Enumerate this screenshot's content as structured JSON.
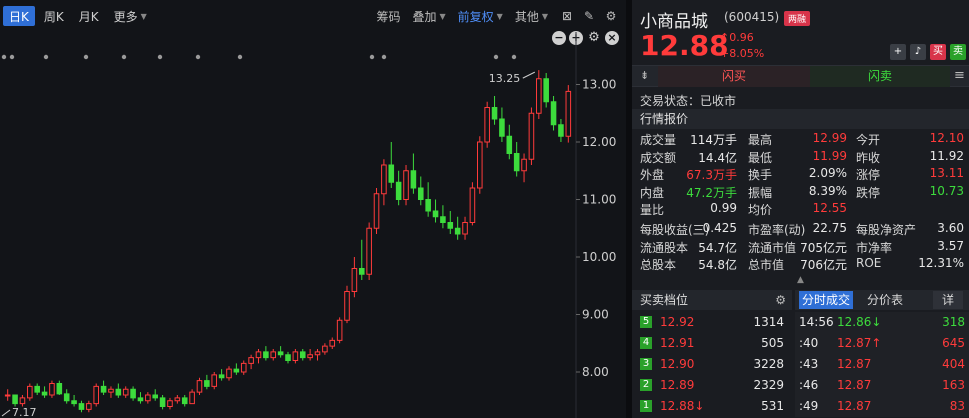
{
  "toolbar": {
    "periods": [
      "日K",
      "周K",
      "月K",
      "更多"
    ],
    "right_items": [
      "筹码",
      "叠加",
      "前复权",
      "其他"
    ]
  },
  "chart_data": {
    "type": "candlestick",
    "y_ticks": [
      "13.00",
      "12.00",
      "11.00",
      "10.00",
      "9.00",
      "8.00"
    ],
    "y_range": [
      7.2,
      13.6
    ],
    "max_label": "13.25",
    "min_label": "7.17",
    "candles": [
      [
        7.6,
        7.7,
        7.5,
        7.6
      ],
      [
        7.6,
        7.6,
        7.4,
        7.45
      ],
      [
        7.45,
        7.6,
        7.4,
        7.55
      ],
      [
        7.55,
        7.8,
        7.5,
        7.75
      ],
      [
        7.75,
        7.8,
        7.6,
        7.65
      ],
      [
        7.65,
        7.75,
        7.55,
        7.6
      ],
      [
        7.6,
        7.85,
        7.55,
        7.8
      ],
      [
        7.8,
        7.85,
        7.6,
        7.62
      ],
      [
        7.62,
        7.7,
        7.45,
        7.5
      ],
      [
        7.5,
        7.6,
        7.4,
        7.45
      ],
      [
        7.45,
        7.5,
        7.3,
        7.35
      ],
      [
        7.35,
        7.5,
        7.3,
        7.45
      ],
      [
        7.45,
        7.8,
        7.4,
        7.75
      ],
      [
        7.75,
        7.85,
        7.6,
        7.65
      ],
      [
        7.65,
        7.75,
        7.55,
        7.7
      ],
      [
        7.7,
        7.8,
        7.55,
        7.6
      ],
      [
        7.6,
        7.75,
        7.55,
        7.7
      ],
      [
        7.7,
        7.75,
        7.5,
        7.55
      ],
      [
        7.55,
        7.65,
        7.45,
        7.5
      ],
      [
        7.5,
        7.65,
        7.45,
        7.6
      ],
      [
        7.6,
        7.7,
        7.5,
        7.55
      ],
      [
        7.55,
        7.6,
        7.35,
        7.4
      ],
      [
        7.4,
        7.55,
        7.35,
        7.5
      ],
      [
        7.5,
        7.6,
        7.45,
        7.55
      ],
      [
        7.55,
        7.6,
        7.4,
        7.45
      ],
      [
        7.45,
        7.7,
        7.45,
        7.65
      ],
      [
        7.65,
        7.9,
        7.6,
        7.85
      ],
      [
        7.85,
        7.95,
        7.7,
        7.75
      ],
      [
        7.75,
        8.0,
        7.7,
        7.95
      ],
      [
        7.95,
        8.05,
        7.85,
        7.9
      ],
      [
        7.9,
        8.1,
        7.85,
        8.05
      ],
      [
        8.05,
        8.15,
        7.95,
        8.0
      ],
      [
        8.0,
        8.2,
        7.95,
        8.15
      ],
      [
        8.15,
        8.3,
        8.05,
        8.25
      ],
      [
        8.25,
        8.4,
        8.15,
        8.35
      ],
      [
        8.35,
        8.45,
        8.2,
        8.25
      ],
      [
        8.25,
        8.4,
        8.2,
        8.35
      ],
      [
        8.35,
        8.45,
        8.25,
        8.3
      ],
      [
        8.3,
        8.35,
        8.15,
        8.2
      ],
      [
        8.2,
        8.4,
        8.15,
        8.35
      ],
      [
        8.35,
        8.4,
        8.2,
        8.25
      ],
      [
        8.25,
        8.4,
        8.2,
        8.3
      ],
      [
        8.3,
        8.4,
        8.2,
        8.35
      ],
      [
        8.35,
        8.5,
        8.3,
        8.45
      ],
      [
        8.45,
        8.6,
        8.4,
        8.55
      ],
      [
        8.55,
        8.95,
        8.5,
        8.9
      ],
      [
        8.9,
        9.5,
        8.85,
        9.4
      ],
      [
        9.4,
        10.0,
        9.3,
        9.8
      ],
      [
        9.8,
        10.3,
        9.6,
        9.7
      ],
      [
        9.7,
        10.6,
        9.6,
        10.5
      ],
      [
        10.5,
        11.2,
        10.4,
        11.1
      ],
      [
        11.1,
        11.7,
        10.9,
        11.6
      ],
      [
        11.6,
        12.0,
        11.2,
        11.3
      ],
      [
        11.3,
        11.5,
        10.9,
        11.0
      ],
      [
        11.0,
        11.6,
        10.9,
        11.5
      ],
      [
        11.5,
        11.8,
        11.1,
        11.2
      ],
      [
        11.2,
        11.4,
        10.9,
        11.0
      ],
      [
        11.0,
        11.3,
        10.7,
        10.8
      ],
      [
        10.8,
        11.0,
        10.6,
        10.7
      ],
      [
        10.7,
        10.9,
        10.5,
        10.6
      ],
      [
        10.6,
        10.8,
        10.4,
        10.5
      ],
      [
        10.5,
        10.7,
        10.3,
        10.4
      ],
      [
        10.4,
        10.7,
        10.3,
        10.6
      ],
      [
        10.6,
        11.3,
        10.55,
        11.2
      ],
      [
        11.2,
        12.1,
        11.1,
        12.0
      ],
      [
        12.0,
        12.7,
        11.9,
        12.6
      ],
      [
        12.6,
        12.8,
        12.3,
        12.4
      ],
      [
        12.4,
        12.6,
        12.0,
        12.1
      ],
      [
        12.1,
        12.3,
        11.7,
        11.8
      ],
      [
        11.8,
        12.0,
        11.4,
        11.5
      ],
      [
        11.5,
        11.8,
        11.3,
        11.7
      ],
      [
        11.7,
        12.6,
        11.6,
        12.5
      ],
      [
        12.5,
        13.25,
        12.4,
        13.1
      ],
      [
        13.1,
        13.2,
        12.6,
        12.7
      ],
      [
        12.7,
        12.8,
        12.2,
        12.3
      ],
      [
        12.3,
        12.4,
        12.0,
        12.1
      ],
      [
        12.1,
        12.99,
        11.99,
        12.88
      ]
    ]
  },
  "stock": {
    "name": "小商品城",
    "code": "(600415)",
    "tag": "两融",
    "price": "12.88",
    "change": "0.96",
    "pct": "+8.05%"
  },
  "action_buttons": [
    "+",
    "♪",
    "买",
    "卖"
  ],
  "flash": {
    "buy": "闪买",
    "sell": "闪卖"
  },
  "trade_status": "交易状态：已收市",
  "quote_header": "行情报价",
  "quote_rows": [
    [
      [
        "成交量",
        "114万手",
        "white"
      ],
      [
        "最高",
        "12.99",
        "up"
      ],
      [
        "今开",
        "12.10",
        "up"
      ]
    ],
    [
      [
        "成交额",
        "14.4亿",
        "white"
      ],
      [
        "最低",
        "11.99",
        "up"
      ],
      [
        "昨收",
        "11.92",
        "white"
      ]
    ],
    [
      [
        "外盘",
        "67.3万手",
        "up"
      ],
      [
        "换手",
        "2.09%",
        "white"
      ],
      [
        "涨停",
        "13.11",
        "up"
      ]
    ],
    [
      [
        "内盘",
        "47.2万手",
        "down"
      ],
      [
        "振幅",
        "8.39%",
        "white"
      ],
      [
        "跌停",
        "10.73",
        "down"
      ]
    ],
    [
      [
        "量比",
        "0.99",
        "white"
      ],
      [
        "均价",
        "12.55",
        "up"
      ],
      [
        "",
        "",
        " white"
      ]
    ]
  ],
  "fund_rows": [
    [
      [
        "每股收益(三)",
        "0.425",
        "white"
      ],
      [
        "市盈率(动)",
        "22.75",
        "white"
      ],
      [
        "每股净资产",
        "3.60",
        "white"
      ]
    ],
    [
      [
        "流通股本",
        "54.7亿",
        "white"
      ],
      [
        "流通市值",
        "705亿元",
        "white"
      ],
      [
        "市净率",
        "3.57",
        "white"
      ]
    ],
    [
      [
        "总股本",
        "54.8亿",
        "white"
      ],
      [
        "总市值",
        "706亿元",
        "white"
      ],
      [
        "ROE",
        "12.31%",
        "white"
      ]
    ]
  ],
  "orderbook_header": "买卖档位",
  "orderbook": [
    [
      "5",
      "12.92",
      "1314"
    ],
    [
      "4",
      "12.91",
      "505"
    ],
    [
      "3",
      "12.90",
      "3228"
    ],
    [
      "2",
      "12.89",
      "2329"
    ],
    [
      "1",
      "12.88↓",
      "531"
    ]
  ],
  "ticks_tabs": [
    "分时成交",
    "分价表",
    "详"
  ],
  "ticks": [
    [
      "14:56",
      "12.86↓",
      "318",
      "down"
    ],
    [
      ":40",
      "12.87↑",
      "645",
      "up"
    ],
    [
      ":43",
      "12.87",
      "404",
      "up"
    ],
    [
      ":46",
      "12.87",
      "163",
      "up"
    ],
    [
      ":49",
      "12.87",
      "83",
      "up"
    ]
  ]
}
